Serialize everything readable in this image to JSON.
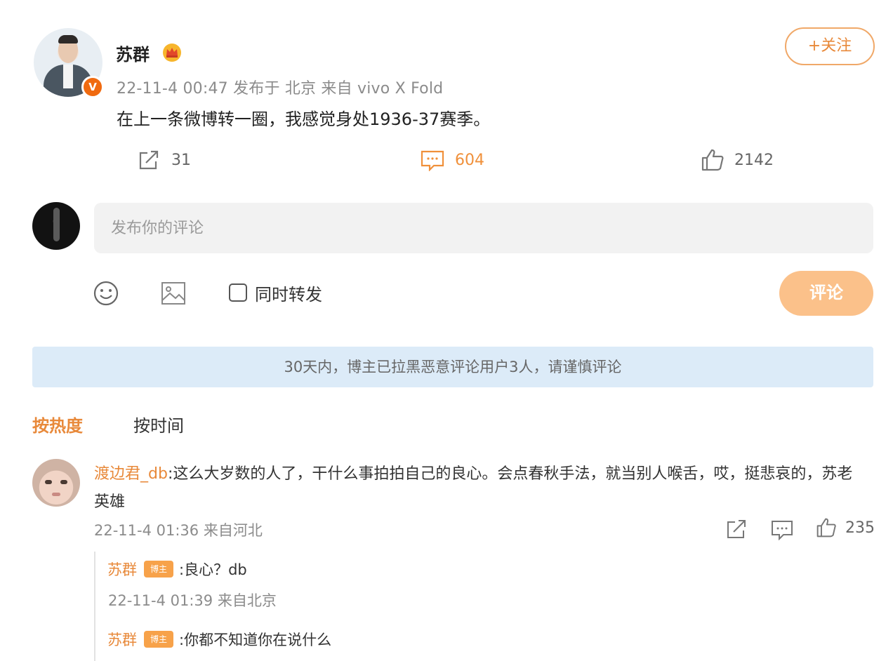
{
  "post": {
    "author": "苏群",
    "badge": "V",
    "meta": "22-11-4 00:47  发布于 北京  来自 vivo X Fold",
    "text": "在上一条微博转一圈，我感觉身处1936-37赛季。",
    "follow_label": "+关注",
    "actions": {
      "repost_count": "31",
      "comment_count": "604",
      "like_count": "2142"
    }
  },
  "composer": {
    "placeholder": "发布你的评论",
    "repost_label": "同时转发",
    "submit_label": "评论"
  },
  "notice": "30天内，博主已拉黑恶意评论用户3人，请谨慎评论",
  "sort_tabs": {
    "hot": "按热度",
    "time": "按时间"
  },
  "comment": {
    "author": "渡边君_db",
    "text": ":这么大岁数的人了，干什么事拍拍自己的良心。会点春秋手法，就当别人喉舌，哎，挺悲哀的，苏老英雄",
    "meta": "22-11-4 01:36 来自河北",
    "like_count": "235",
    "replies": [
      {
        "author": "苏群",
        "tag": "博主",
        "text": ":良心？db",
        "meta": "22-11-4 01:39 来自北京"
      },
      {
        "author": "苏群",
        "tag": "博主",
        "text": ":你都不知道你在说什么"
      }
    ]
  },
  "colors": {
    "accent": "#e8893a",
    "notice_bg": "#dcebf8",
    "submit_bg": "#fbc18a"
  }
}
